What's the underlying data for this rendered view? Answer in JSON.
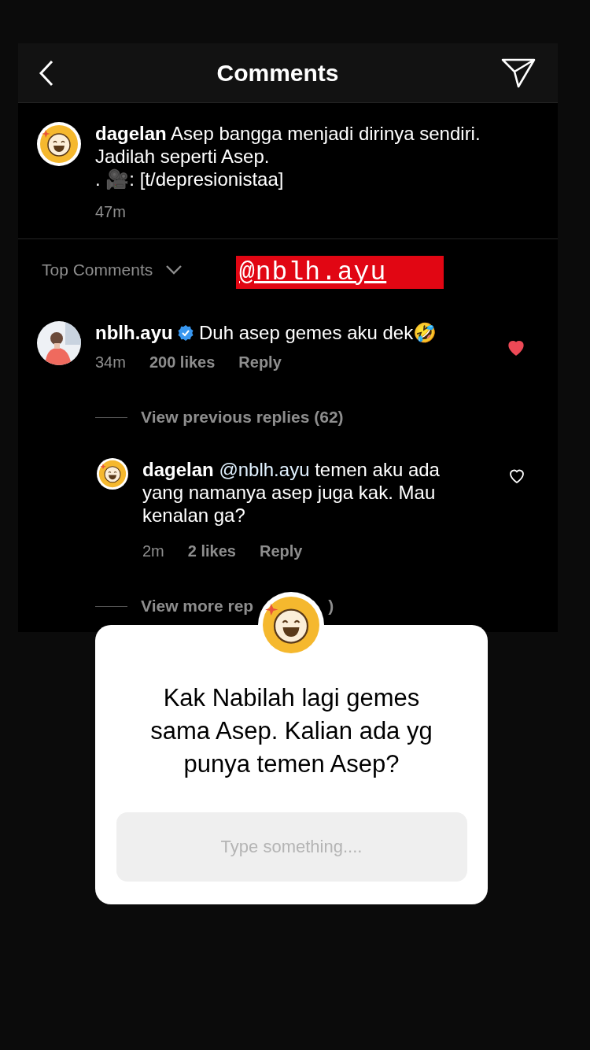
{
  "header": {
    "title": "Comments"
  },
  "post": {
    "username": "dagelan",
    "caption_lines": [
      "Asep bangga menjadi dirinya sendiri.",
      "Jadilah seperti Asep.",
      ". 🎥: [t/depresionistaa]"
    ],
    "time": "47m"
  },
  "sort": {
    "label": "Top Comments"
  },
  "mention_sticker": {
    "text": "@nblh.ayu"
  },
  "comments": [
    {
      "kind": "comment",
      "username": "nblh.ayu",
      "verified": true,
      "text": "Duh asep gemes aku dek🤣",
      "time": "34m",
      "likes": "200 likes",
      "reply": "Reply",
      "liked": true
    },
    {
      "kind": "reply",
      "username": "dagelan",
      "verified": false,
      "mention": "@nblh.ayu",
      "text": "temen aku ada yang namanya asep juga kak. Mau kenalan ga?",
      "time": "2m",
      "likes": "2 likes",
      "reply": "Reply",
      "liked": false
    }
  ],
  "view_previous": "View previous replies (62)",
  "view_more": {
    "start": "View more rep",
    "end": ")"
  },
  "question_sticker": {
    "question": "Kak Nabilah lagi gemes sama Asep. Kalian ada yg punya temen Asep?",
    "placeholder": "Type something...."
  }
}
